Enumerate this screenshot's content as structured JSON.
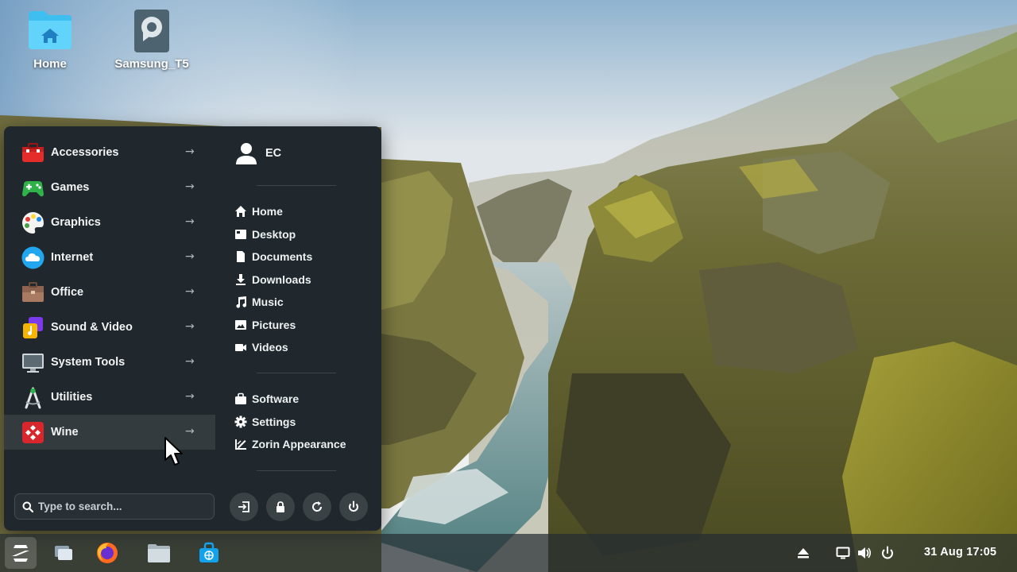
{
  "desktop": {
    "icons": [
      {
        "label": "Home"
      },
      {
        "label": "Samsung_T5"
      }
    ]
  },
  "menu": {
    "categories": [
      {
        "label": "Accessories",
        "icon": "toolbox-icon"
      },
      {
        "label": "Games",
        "icon": "gamepad-icon"
      },
      {
        "label": "Graphics",
        "icon": "palette-icon"
      },
      {
        "label": "Internet",
        "icon": "cloud-icon"
      },
      {
        "label": "Office",
        "icon": "briefcase-icon"
      },
      {
        "label": "Sound & Video",
        "icon": "music-note-icon"
      },
      {
        "label": "System Tools",
        "icon": "monitor-icon"
      },
      {
        "label": "Utilities",
        "icon": "compass-icon"
      },
      {
        "label": "Wine",
        "icon": "wine-icon"
      }
    ],
    "active_category": "Wine",
    "arrow": "→",
    "user": {
      "name": "EC",
      "icon": "user-icon"
    },
    "places": [
      {
        "label": "Home",
        "icon": "home-icon"
      },
      {
        "label": "Desktop",
        "icon": "desktop-icon"
      },
      {
        "label": "Documents",
        "icon": "document-icon"
      },
      {
        "label": "Downloads",
        "icon": "download-icon"
      },
      {
        "label": "Music",
        "icon": "music-icon"
      },
      {
        "label": "Pictures",
        "icon": "picture-icon"
      },
      {
        "label": "Videos",
        "icon": "video-icon"
      }
    ],
    "system": [
      {
        "label": "Software",
        "icon": "software-bag-icon"
      },
      {
        "label": "Settings",
        "icon": "gear-icon"
      },
      {
        "label": "Zorin Appearance",
        "icon": "appearance-icon"
      }
    ],
    "search": {
      "placeholder": "Type to search..."
    },
    "power_buttons": [
      "logout-icon",
      "lock-icon",
      "restart-icon",
      "power-icon"
    ]
  },
  "taskbar": {
    "apps": [
      "zorin-menu-icon",
      "window-switcher-icon",
      "firefox-icon",
      "files-icon",
      "software-store-icon"
    ],
    "tray": [
      "eject-icon",
      "display-icon",
      "volume-icon",
      "power-icon"
    ],
    "clock": "31 Aug  17:05"
  },
  "colors": {
    "menu_bg": "#1e262c",
    "accent_blue": "#15a6f0",
    "taskbar_bg": "#262e32"
  }
}
